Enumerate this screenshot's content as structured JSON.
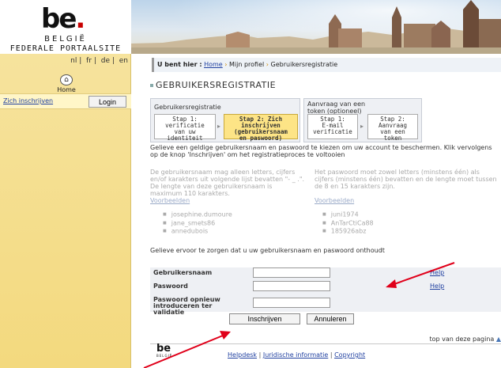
{
  "logo": {
    "mark": "be",
    "country": "BELGIË",
    "portal": "FEDERALE PORTAALSITE"
  },
  "banner": {
    "icon": "city-skyline-photo"
  },
  "sidebar": {
    "languages": [
      "nl",
      "fr",
      "de",
      "en"
    ],
    "home_label": "Home",
    "register_link": "Zich inschrijven",
    "login_button": "Login"
  },
  "breadcrumb": {
    "prefix": "U bent hier :",
    "home": "Home",
    "profile": "Mijn profiel",
    "current": "Gebruikersregistratie"
  },
  "page_title": "GEBRUIKERSREGISTRATIE",
  "steps": {
    "group_a_label": "Gebruikersregistratie",
    "group_b_label": "Aanvraag van een token (optioneel)",
    "items": [
      {
        "l1": "Stap 1:",
        "l2": "verificatie",
        "l3": "van uw",
        "l4": "identiteit"
      },
      {
        "l1": "Stap 2: Zich",
        "l2": "inschrijven",
        "l3": "(gebruikersnaam",
        "l4": "en paswoord)"
      },
      {
        "l1": "Stap 1:",
        "l2": "E-mail",
        "l3": "verificatie",
        "l4": ""
      },
      {
        "l1": "Stap 2:",
        "l2": "Aanvraag",
        "l3": "van een",
        "l4": "token"
      }
    ]
  },
  "intro": "Gelieve een geldige gebruikersnaam en paswoord te kiezen om uw account te beschermen. Klik vervolgens op de knop 'Inschrijven' om het registratieproces te voltooien",
  "rules": {
    "username": "De gebruikersnaam mag alleen letters, cijfers en/of karakters uit volgende lijst bevatten \"- _ .\". De lengte van deze gebruikersnaam is maximum 110 karakters.",
    "password": "Het paswoord moet zowel letters (minstens één) als cijfers (minstens één) bevatten en de lengte moet tussen de 8 en 15 karakters zijn.",
    "examples_label": "Voorbeelden",
    "username_examples": [
      "josephine.dumoure",
      "jane_smets86",
      "annedubois"
    ],
    "password_examples": [
      "juni1974",
      "AnTarCtiCa88",
      "185926abz"
    ]
  },
  "remember_note": "Gelieve ervoor te zorgen dat u uw gebruikersnaam en paswoord onthoudt",
  "form": {
    "username_label": "Gebruikersnaam",
    "password_label": "Paswoord",
    "password_repeat_label": "Paswoord opnieuw introduceren ter validatie",
    "help": "Help",
    "submit": "Inschrijven",
    "cancel": "Annuleren"
  },
  "footer": {
    "top_link": "top van deze pagina",
    "logo": "be",
    "logo_sub": "BELGIË",
    "links": [
      "Helpdesk",
      "Juridische informatie",
      "Copyright"
    ]
  },
  "annotations": {
    "arrow_color": "#e0001a"
  }
}
